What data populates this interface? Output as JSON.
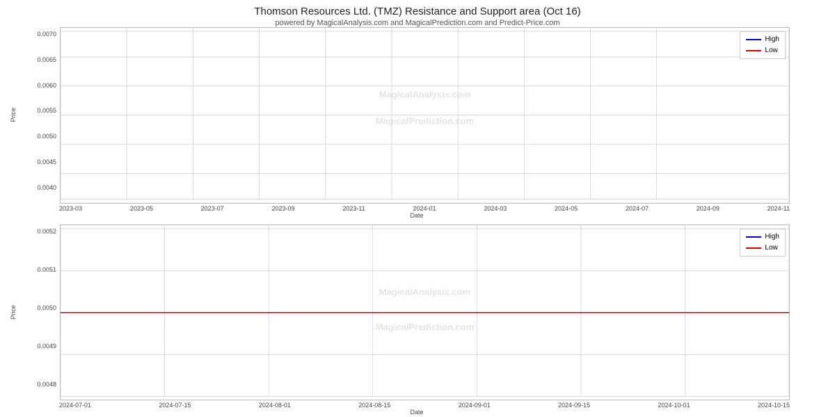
{
  "title": "Thomson Resources Ltd. (TMZ) Resistance and Support area (Oct 16)",
  "subtitle": "powered by MagicalAnalysis.com and MagicalPrediction.com and Predict-Price.com",
  "watermark1": "MagicalAnalysis.com — MagicalPrediction.com",
  "watermark2": "MagicalAnalysis.com — MagicalPrediction.com",
  "chart1": {
    "y_axis_label": "Price",
    "y_ticks": [
      "0.0070",
      "0.0065",
      "0.0060",
      "0.0055",
      "0.0050",
      "0.0045",
      "0.0040"
    ],
    "x_ticks": [
      "2023-03",
      "2023-05",
      "2023-07",
      "2023-09",
      "2023-11",
      "2024-01",
      "2024-03",
      "2024-05",
      "2024-07",
      "2024-09",
      "2024-11"
    ],
    "x_label": "Date",
    "legend": {
      "high_label": "High",
      "low_label": "Low"
    }
  },
  "chart2": {
    "y_axis_label": "Price",
    "y_ticks": [
      "0.0052",
      "0.0051",
      "0.0050",
      "0.0049",
      "0.0048"
    ],
    "x_ticks": [
      "2024-07-01",
      "2024-07-15",
      "2024-08-01",
      "2024-08-15",
      "2024-09-01",
      "2024-09-15",
      "2024-10-01",
      "2024-10-15"
    ],
    "x_label": "Date",
    "legend": {
      "high_label": "High",
      "low_label": "Low"
    }
  },
  "colors": {
    "high": "#0000cc",
    "low": "#cc0000",
    "grid": "#cccccc",
    "watermark": "#bbbbbb"
  }
}
